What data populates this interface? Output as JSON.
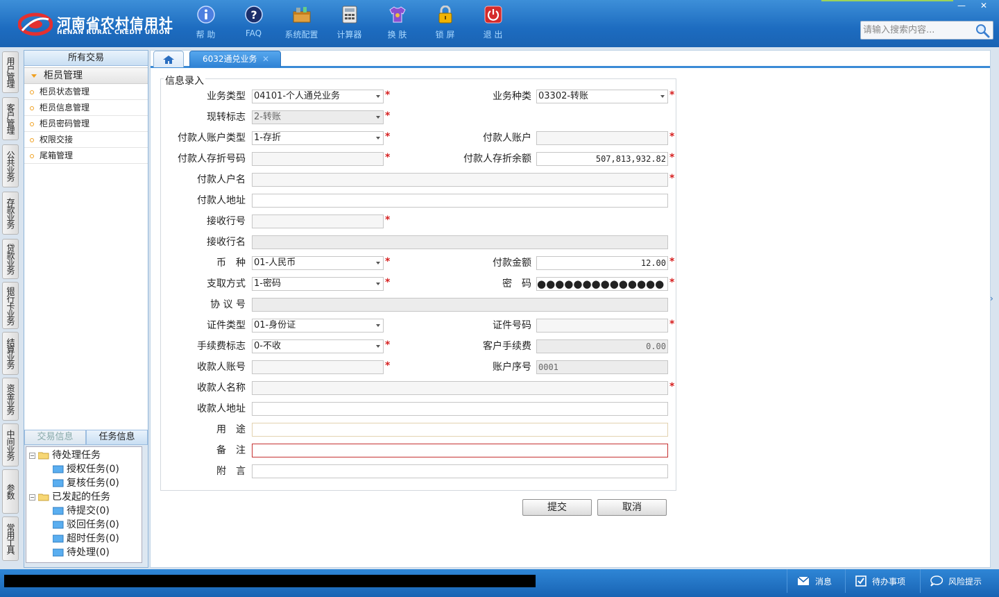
{
  "header": {
    "logo_cn": "河南省农村信用社",
    "logo_en": "HENAN RURAL CREDIT UNION",
    "toolbar": [
      {
        "label": "帮 助",
        "icon": "info-icon"
      },
      {
        "label": "FAQ",
        "icon": "help-icon"
      },
      {
        "label": "系统配置",
        "icon": "config-icon"
      },
      {
        "label": "计算器",
        "icon": "calculator-icon"
      },
      {
        "label": "换 肤",
        "icon": "shirt-icon"
      },
      {
        "label": "锁 屏",
        "icon": "lock-icon"
      },
      {
        "label": "退 出",
        "icon": "power-icon"
      }
    ],
    "search_placeholder": "请输入搜索内容...",
    "window_buttons": [
      "—",
      "✕"
    ]
  },
  "vnav": [
    "用户管理",
    "客户管理",
    "公共业务",
    "存款业务",
    "贷款业务",
    "银行卡业务",
    "结算业务",
    "资金业务",
    "中间业务",
    "参数",
    "常用工具"
  ],
  "left_panel": {
    "title": "所有交易",
    "group": "柜员管理",
    "items": [
      "柜员状态管理",
      "柜员信息管理",
      "柜员密码管理",
      "权限交接",
      "尾箱管理"
    ],
    "tabs": [
      "交易信息",
      "任务信息"
    ],
    "tree": {
      "pending": "待处理任务",
      "pending_children": [
        "授权任务(0)",
        "复核任务(0)"
      ],
      "initiated": "已发起的任务",
      "initiated_children": [
        "待提交(0)",
        "驳回任务(0)",
        "超时任务(0)",
        "待处理(0)"
      ]
    }
  },
  "tabs": {
    "active": "6032通兑业务",
    "close": "✕"
  },
  "form": {
    "legend": "信息录入",
    "labels": {
      "biz_type": "业务类型",
      "biz_kind": "业务种类",
      "cash_flag": "现转标志",
      "payer_acct_type": "付款人账户类型",
      "payer_acct": "付款人账户",
      "payer_book_no": "付款人存折号码",
      "payer_balance": "付款人存折余额",
      "payer_name": "付款人户名",
      "payer_addr": "付款人地址",
      "recv_bank_no": "接收行号",
      "recv_bank_name": "接收行名",
      "currency": "币　种",
      "amount": "付款金额",
      "withdraw_mode": "支取方式",
      "password": "密　码",
      "agreement_no": "协 议 号",
      "id_type": "证件类型",
      "id_no": "证件号码",
      "fee_flag": "手续费标志",
      "cust_fee": "客户手续费",
      "payee_acct": "收款人账号",
      "acct_seq": "账户序号",
      "payee_name": "收款人名称",
      "payee_addr": "收款人地址",
      "purpose": "用　途",
      "remark": "备　注",
      "postscript": "附　言"
    },
    "values": {
      "biz_type": "04101-个人通兑业务",
      "biz_kind": "03302-转账",
      "cash_flag": "2-转账",
      "payer_acct_type": "1-存折",
      "payer_acct": "",
      "payer_book_no": "",
      "payer_balance": "507,813,932.82",
      "payer_name": "",
      "payer_addr": "",
      "recv_bank_no": "",
      "recv_bank_name": "",
      "currency": "01-人民币",
      "amount": "12.00",
      "withdraw_mode": "1-密码",
      "password": "●●●●●●●●●●●●●●",
      "agreement_no": "",
      "id_type": "01-身份证",
      "id_no": "",
      "fee_flag": "0-不收",
      "cust_fee": "0.00",
      "payee_acct": "",
      "acct_seq": "0001",
      "payee_name": "",
      "payee_addr": "",
      "purpose": "",
      "remark": "",
      "postscript": ""
    },
    "required_mark": "*",
    "submit_label": "提交",
    "cancel_label": "取消"
  },
  "status_bar": {
    "items": [
      {
        "label": "消息",
        "icon": "mail-icon"
      },
      {
        "label": "待办事项",
        "icon": "checkbox-icon"
      },
      {
        "label": "风险提示",
        "icon": "chat-icon"
      }
    ]
  },
  "colors": {
    "header_blue": "#1d6cc0",
    "required_red": "#d62020",
    "tab_blue": "#2f82d4"
  }
}
